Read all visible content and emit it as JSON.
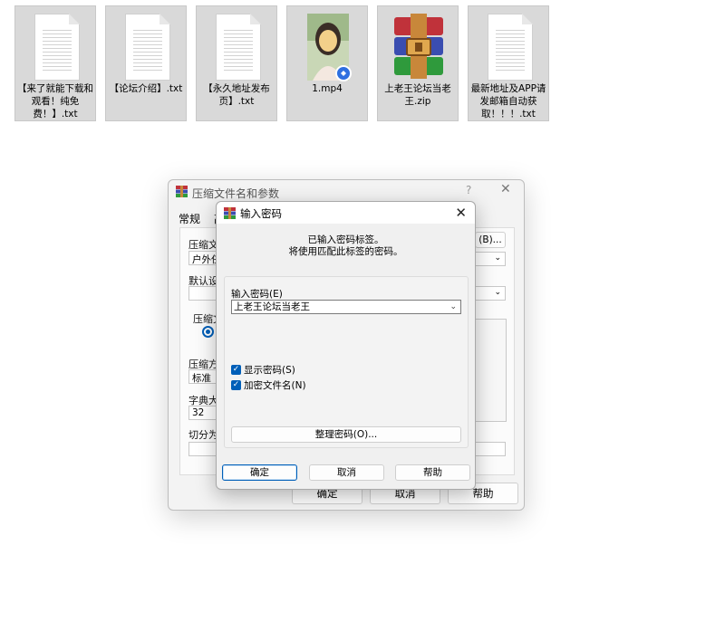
{
  "files": [
    {
      "name": "【来了就能下载和观看！纯免费！】.txt",
      "kind": "txt"
    },
    {
      "name": "【论坛介绍】.txt",
      "kind": "txt"
    },
    {
      "name": "【永久地址发布页】.txt",
      "kind": "txt"
    },
    {
      "name": "1.mp4",
      "kind": "video"
    },
    {
      "name": "上老王论坛当老王.zip",
      "kind": "archive"
    },
    {
      "name": "最新地址及APP请发邮箱自动获取！！！.txt",
      "kind": "txt"
    }
  ],
  "main_dialog": {
    "title": "压缩文件名和参数",
    "help_glyph": "?",
    "tab_general": "常规",
    "tab_second_fragment": "高",
    "archive_name_label": "压缩文件",
    "archive_name_value": "户外任",
    "browse_label": "(B)...",
    "profile_label": "默认设置",
    "format_label": "压缩文",
    "method_label": "压缩方式",
    "method_value": "标准",
    "dict_label": "字典大小",
    "dict_value": "32",
    "split_label": "切分为分卷",
    "ok": "确定",
    "cancel": "取消",
    "help": "帮助"
  },
  "pw_dialog": {
    "title": "输入密码",
    "message_line1": "已输入密码标签。",
    "message_line2": "将使用匹配此标签的密码。",
    "enter_label": "输入密码(E)",
    "password_value": "上老王论坛当老王",
    "show_password": "显示密码(S)",
    "encrypt_names": "加密文件名(N)",
    "manage": "整理密码(O)...",
    "ok": "确定",
    "cancel": "取消",
    "help": "帮助"
  },
  "colors": {
    "accent": "#005fb8",
    "tile_bg": "#d9d9d9"
  }
}
